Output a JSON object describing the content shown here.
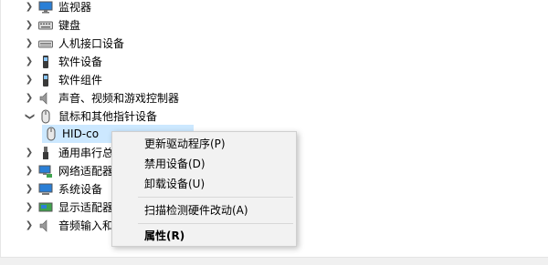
{
  "tree": {
    "items": [
      {
        "label": "监视器",
        "icon": "monitor-icon",
        "expanded": false
      },
      {
        "label": "键盘",
        "icon": "keyboard-icon",
        "expanded": false
      },
      {
        "label": "人机接口设备",
        "icon": "hid-icon",
        "expanded": false
      },
      {
        "label": "软件设备",
        "icon": "software-device-icon",
        "expanded": false
      },
      {
        "label": "软件组件",
        "icon": "software-component-icon",
        "expanded": false
      },
      {
        "label": "声音、视频和游戏控制器",
        "icon": "speaker-icon",
        "expanded": false
      },
      {
        "label": "鼠标和其他指针设备",
        "icon": "mouse-icon",
        "expanded": true
      },
      {
        "label": "通用串行总",
        "icon": "usb-icon",
        "expanded": false
      },
      {
        "label": "网络适配器",
        "icon": "network-icon",
        "expanded": false
      },
      {
        "label": "系统设备",
        "icon": "system-device-icon",
        "expanded": false
      },
      {
        "label": "显示适配器",
        "icon": "display-adapter-icon",
        "expanded": false
      },
      {
        "label": "音频输入和",
        "icon": "audio-icon",
        "expanded": false
      }
    ],
    "child": {
      "label": "HID-co",
      "icon": "mouse-icon",
      "selected": true
    }
  },
  "context_menu": {
    "items": [
      {
        "label": "更新驱动程序(P)"
      },
      {
        "label": "禁用设备(D)"
      },
      {
        "label": "卸载设备(U)"
      },
      {
        "label": "扫描检测硬件改动(A)"
      },
      {
        "label": "属性(R)",
        "bold": true
      }
    ]
  }
}
